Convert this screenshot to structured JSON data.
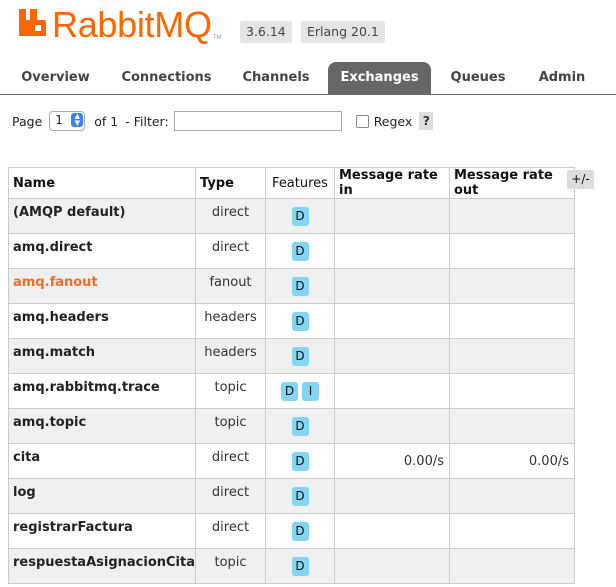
{
  "header": {
    "logo_text": "RabbitMQ",
    "logo_tm": "TM",
    "version_rabbitmq": "3.6.14",
    "version_erlang": "Erlang 20.1"
  },
  "nav": {
    "tabs": [
      {
        "label": "Overview",
        "active": false
      },
      {
        "label": "Connections",
        "active": false
      },
      {
        "label": "Channels",
        "active": false
      },
      {
        "label": "Exchanges",
        "active": true
      },
      {
        "label": "Queues",
        "active": false
      },
      {
        "label": "Admin",
        "active": false
      }
    ]
  },
  "filter": {
    "page_label": "Page",
    "page_value": "1",
    "of_label": "of 1",
    "filter_label": "- Filter:",
    "filter_value": "",
    "regex_label": "Regex",
    "regex_checked": false,
    "help_label": "?"
  },
  "table": {
    "headers": {
      "name": "Name",
      "type": "Type",
      "features": "Features",
      "rate_in": "Message rate in",
      "rate_out": "Message rate out"
    },
    "column_selector": "+/-",
    "rows": [
      {
        "name": "(AMQP default)",
        "type": "direct",
        "features": [
          "D"
        ],
        "rate_in": "",
        "rate_out": "",
        "highlight": false
      },
      {
        "name": "amq.direct",
        "type": "direct",
        "features": [
          "D"
        ],
        "rate_in": "",
        "rate_out": "",
        "highlight": false
      },
      {
        "name": "amq.fanout",
        "type": "fanout",
        "features": [
          "D"
        ],
        "rate_in": "",
        "rate_out": "",
        "highlight": true
      },
      {
        "name": "amq.headers",
        "type": "headers",
        "features": [
          "D"
        ],
        "rate_in": "",
        "rate_out": "",
        "highlight": false
      },
      {
        "name": "amq.match",
        "type": "headers",
        "features": [
          "D"
        ],
        "rate_in": "",
        "rate_out": "",
        "highlight": false
      },
      {
        "name": "amq.rabbitmq.trace",
        "type": "topic",
        "features": [
          "D",
          "I"
        ],
        "rate_in": "",
        "rate_out": "",
        "highlight": false
      },
      {
        "name": "amq.topic",
        "type": "topic",
        "features": [
          "D"
        ],
        "rate_in": "",
        "rate_out": "",
        "highlight": false
      },
      {
        "name": "cita",
        "type": "direct",
        "features": [
          "D"
        ],
        "rate_in": "0.00/s",
        "rate_out": "0.00/s",
        "highlight": false
      },
      {
        "name": "log",
        "type": "direct",
        "features": [
          "D"
        ],
        "rate_in": "",
        "rate_out": "",
        "highlight": false
      },
      {
        "name": "registrarFactura",
        "type": "direct",
        "features": [
          "D"
        ],
        "rate_in": "",
        "rate_out": "",
        "highlight": false
      },
      {
        "name": "respuestaAsignacionCita",
        "type": "topic",
        "features": [
          "D"
        ],
        "rate_in": "",
        "rate_out": "",
        "highlight": false
      }
    ]
  },
  "colors": {
    "brand": "#ff6600",
    "active_tab": "#666666",
    "feature_badge": "#84d5f3",
    "link_highlight": "#f16b2b"
  }
}
